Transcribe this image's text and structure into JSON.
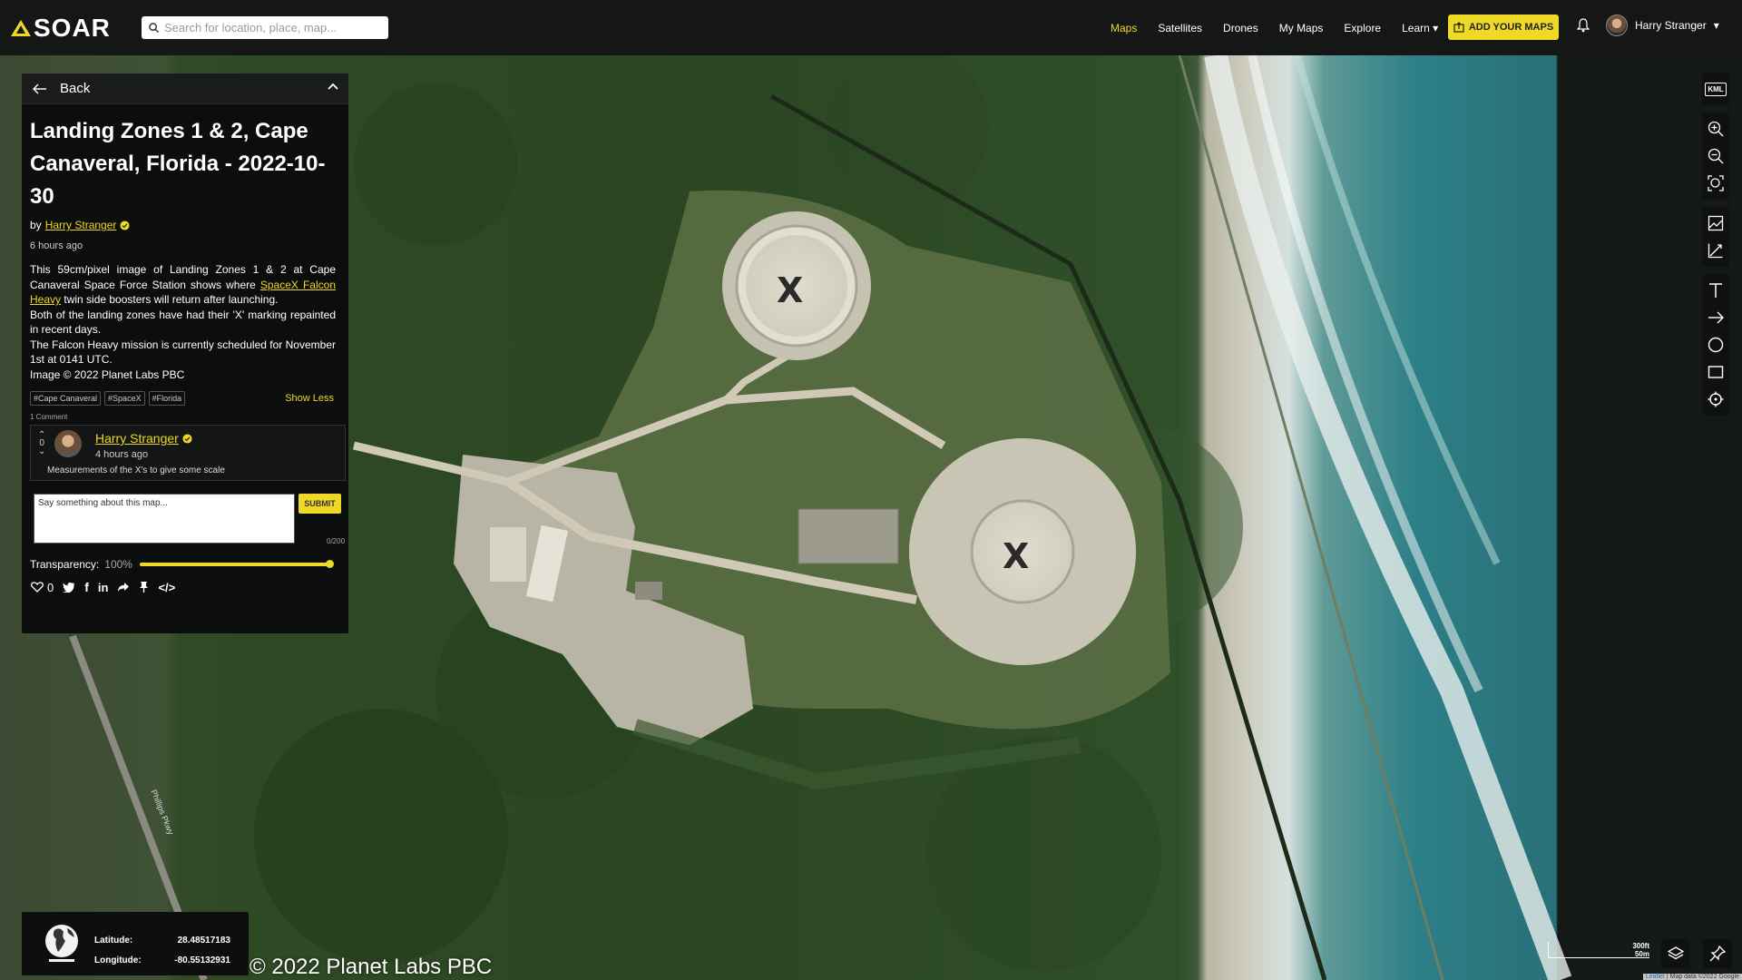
{
  "app": {
    "name": "SOAR"
  },
  "search": {
    "placeholder": "Search for location, place, map..."
  },
  "nav": {
    "items": [
      "Maps",
      "Satellites",
      "Drones",
      "My Maps",
      "Explore",
      "Learn"
    ],
    "active": "Maps"
  },
  "add_maps_label": "ADD YOUR MAPS",
  "user": {
    "name": "Harry Stranger"
  },
  "panel": {
    "back_label": "Back",
    "title": "Landing Zones 1 & 2, Cape Canaveral, Florida - 2022-10-30",
    "by_prefix": "by",
    "author": "Harry Stranger",
    "time": "6 hours ago",
    "desc_1a": "This 59cm/pixel image of Landing Zones 1 & 2 at Cape Canaveral Space Force Station shows where",
    "desc_1_link": "SpaceX Falcon Heavy",
    "desc_1b": "twin side boosters will return after launching.",
    "desc_2": "Both of the landing zones have had their 'X' marking repainted in recent days.",
    "desc_3": "The Falcon Heavy mission is currently scheduled for November 1st at 0141 UTC.",
    "desc_4": "Image © 2022 Planet Labs PBC",
    "tags": [
      "#Cape Canaveral",
      "#SpaceX",
      "#Florida"
    ],
    "show_less": "Show Less",
    "comment_count": "1 Comment",
    "comment": {
      "votes": "0",
      "author": "Harry Stranger",
      "time": "4 hours ago",
      "text": "Measurements of the X's to give some scale"
    },
    "comment_placeholder": "Say something about this map...",
    "submit_label": "SUBMIT",
    "char_count": "0/200",
    "transparency_label": "Transparency:",
    "transparency_value": "100%",
    "transparency_level": 1.0,
    "likes": "0"
  },
  "tools": [
    "kml-icon",
    "zoom-in-icon",
    "zoom-out-icon",
    "zoom-fit-icon",
    "image-icon",
    "measure-icon",
    "text-icon",
    "arrow-icon",
    "circle-icon",
    "rectangle-icon",
    "crosshair-icon"
  ],
  "coords": {
    "lat_label": "Latitude:",
    "lat_value": "28.48517183",
    "lon_label": "Longitude:",
    "lon_value": "-80.55132931"
  },
  "map": {
    "credit": "© 2022 Planet Labs PBC",
    "road_label": "Phillips Pkwy",
    "scale_ft": "300ft",
    "scale_m": "50m",
    "attribution_leaflet": "Leaflet",
    "attribution_rest": "| Map data ©2022 Google"
  },
  "colors": {
    "accent": "#eed926",
    "topbar": "#151716",
    "panel": "#0c0d0d"
  }
}
